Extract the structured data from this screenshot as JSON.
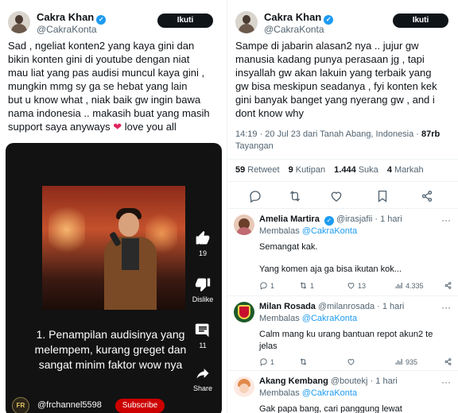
{
  "left": {
    "author": {
      "name": "Cakra Khan",
      "handle": "@CakraKonta",
      "follow_label": "Ikuti"
    },
    "tweet_lines": [
      "Sad , ngeliat konten2 yang kaya gini dan",
      "bikin konten gini di youtube dengan niat",
      "mau liat yang pas audisi muncul kaya gini ,",
      "mungkin mmg sy ga se hebat yang lain",
      "but u know what , niak baik gw ingin bawa",
      "nama indonesia .. makasih buat yang masih"
    ],
    "tweet_last_line": "support saya anyways",
    "tweet_last_line_end": " love you all",
    "video": {
      "like_count": "19",
      "dislike_label": "Dislike",
      "comment_count": "11",
      "share_label": "Share",
      "caption": "1. Penampilan audisinya yang melempem, kurang greget dan sangat minim faktor wow nya",
      "channel_name": "@frchannel5598",
      "channel_avatar_text": "FR",
      "subscribe_label": "Subscribe"
    }
  },
  "right": {
    "author": {
      "name": "Cakra Khan",
      "handle": "@CakraKonta",
      "follow_label": "Ikuti"
    },
    "tweet_lines": [
      "Sampe di jabarin alasan2 nya  .. jujur gw",
      "manusia kadang punya perasaan jg , tapi",
      "insyallah gw akan lakuin yang terbaik yang",
      "gw bisa meskipun seadanya , fyi konten kek",
      "gini banyak banget yang nyerang gw , and i",
      "dont know why"
    ],
    "meta_time": "14:19 · 20 Jul 23 dari Tanah Abang, Indonesia · ",
    "meta_views": "87rb",
    "meta_views_label": "Tayangan",
    "stats": {
      "retweets": "59",
      "retweets_label": "Retweet",
      "quotes": "9",
      "quotes_label": "Kutipan",
      "likes": "1.444",
      "likes_label": "Suka",
      "bookmarks": "4",
      "bookmarks_label": "Markah"
    },
    "replies": [
      {
        "name": "Amelia Martira",
        "handle": "@irasjafii",
        "time": "· 1 hari",
        "replying_label": "Membalas",
        "replying_to": "@CakraKonta",
        "text1": "Semangat kak.",
        "text2": "Yang komen aja ga bisa ikutan kok...",
        "reply_count": "1",
        "retweet_count": "1",
        "like_count": "13",
        "views": "4.335"
      },
      {
        "name": "Milan Rosada",
        "handle": "@milanrosada",
        "time": "· 1 hari",
        "replying_label": "Membalas",
        "replying_to": "@CakraKonta",
        "text1": "Calm mang ku urang bantuan repot akun2 te",
        "text2": "jelas",
        "reply_count": "1",
        "retweet_count": "",
        "like_count": "",
        "views": "935"
      },
      {
        "name": "Akang Kembang",
        "handle": "@boutekj",
        "time": "· 1 hari",
        "replying_label": "Membalas",
        "replying_to": "@CakraKonta",
        "text1": "Gak papa bang, cari panggung lewat"
      }
    ],
    "more_glyph": "···"
  }
}
